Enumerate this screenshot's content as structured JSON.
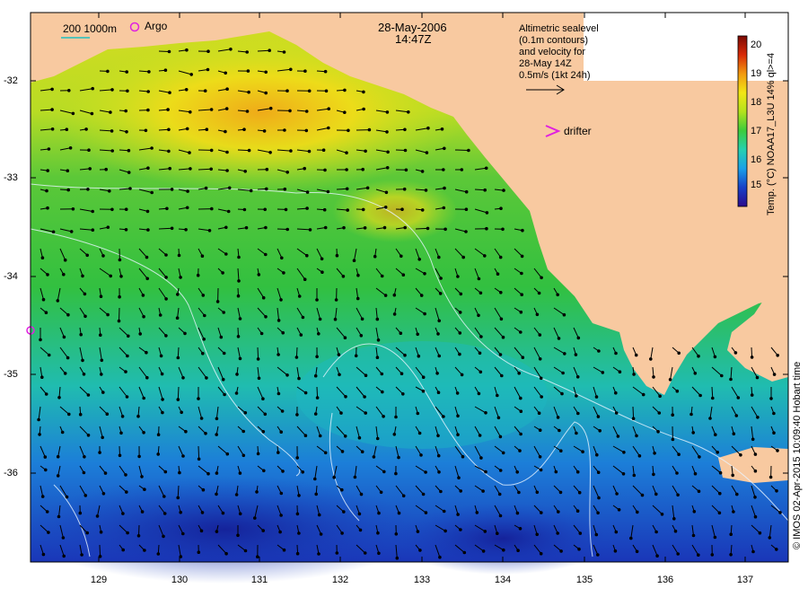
{
  "header": {
    "date": "28-May-2006",
    "time": "14:47Z"
  },
  "legend": {
    "depth_label": "200  1000m",
    "argo_label": "Argo",
    "drifter_label": "drifter",
    "altimetry_lines": [
      "Altimetric sealevel",
      "(0.1m contours)",
      "and velocity for",
      "28-May 14Z",
      "0.5m/s (1kt 24h)"
    ]
  },
  "colorbar": {
    "label": "Temp. (°C) NOAA17_L3U 14% ql>=4",
    "ticks": [
      "20",
      "19",
      "18",
      "17",
      "16",
      "15"
    ],
    "colors": [
      "#2b0a8c",
      "#1840c8",
      "#1aa0e8",
      "#26d0b0",
      "#3ccc3c",
      "#b4e21c",
      "#f2e614",
      "#f29a10",
      "#d82a08",
      "#7a0a04"
    ]
  },
  "axes": {
    "lat_ticks": [
      "-32",
      "-33",
      "-34",
      "-35",
      "-36"
    ],
    "lon_ticks": [
      "129",
      "130",
      "131",
      "132",
      "133",
      "134",
      "135",
      "136",
      "137"
    ]
  },
  "credit": "© IMOS 02-Apr-2015 10:09:40 Hobart time",
  "colors": {
    "land": "#f8c9a0",
    "ocean_warm": "#f0d820",
    "ocean_mid": "#36c43c",
    "ocean_cool": "#1ab4c8",
    "ocean_cold": "#1a40c0",
    "argo": "#e020e0"
  }
}
